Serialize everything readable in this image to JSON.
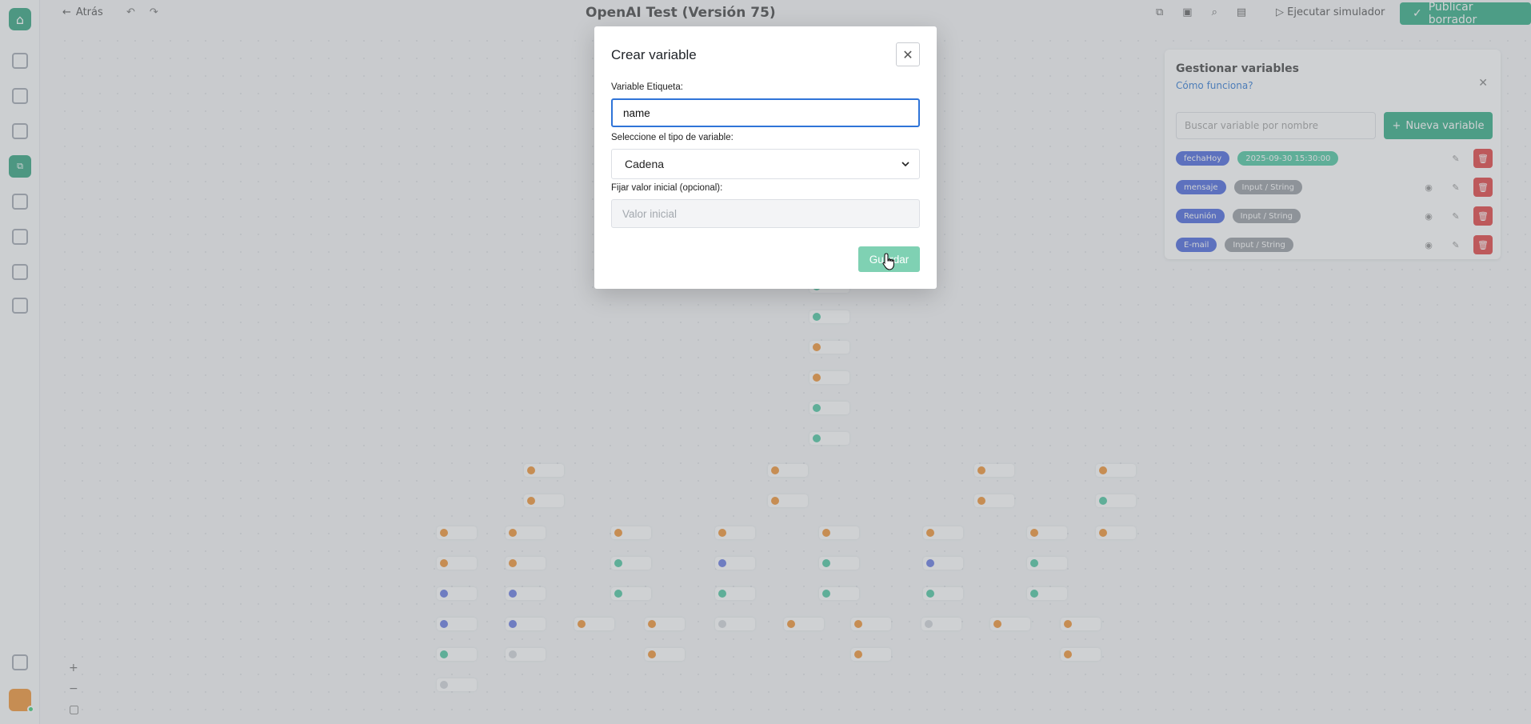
{
  "app": {
    "flow_title": "OpenAI Test (Versión 75)",
    "back_label": "Atrás",
    "simulator_label": "Ejecutar simulador",
    "publish_label": "Publicar borrador"
  },
  "variables_panel": {
    "title": "Gestionar variables",
    "help_link": "Cómo funciona?",
    "search_placeholder": "Buscar variable por nombre",
    "new_button": "Nueva variable",
    "rows": [
      {
        "name": "fechaHoy",
        "value": "2025-09-30 15:30:00"
      },
      {
        "name": "mensaje",
        "value": "Input / String"
      },
      {
        "name": "Reunión",
        "value": "Input / String"
      },
      {
        "name": "E-mail",
        "value": "Input / String"
      }
    ]
  },
  "modal": {
    "title": "Crear variable",
    "label_field": "Variable Etiqueta:",
    "label_value": "name",
    "type_field": "Seleccione el tipo de variable:",
    "type_value": "Cadena",
    "initial_field": "Fijar valor inicial (opcional):",
    "initial_placeholder": "Valor inicial",
    "save_button": "Guardar"
  },
  "colors": {
    "accent_green": "#1fa67a",
    "save_disabled": "#7fd1b3",
    "focus_blue": "#2f74d8",
    "delete_red": "#e03131"
  }
}
